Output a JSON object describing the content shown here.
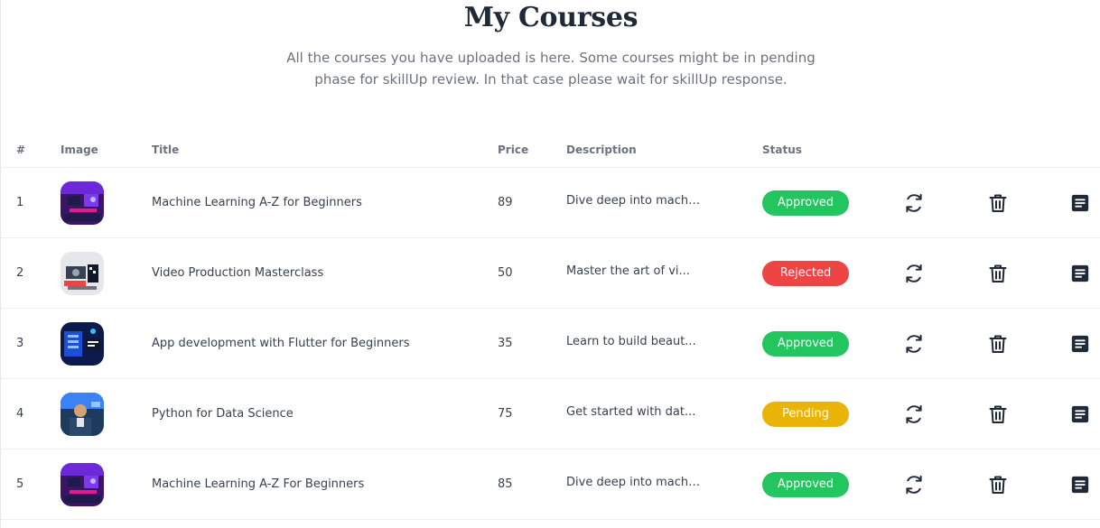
{
  "header": {
    "title": "My Courses",
    "subtitle": "All the courses you have uploaded is here. Some courses might be in pending phase for skillUp review. In that case please wait for skillUp response."
  },
  "table": {
    "columns": [
      "#",
      "Image",
      "Title",
      "Price",
      "Description",
      "Status"
    ],
    "rows": [
      {
        "num": "1",
        "image": "ml-thumbnail",
        "title": "Machine Learning A-Z for Beginners",
        "price": "89",
        "description": "Dive deep into machi...",
        "status": "Approved"
      },
      {
        "num": "2",
        "image": "video-thumbnail",
        "title": "Video Production Masterclass",
        "price": "50",
        "description": "Master the art of vi...",
        "status": "Rejected"
      },
      {
        "num": "3",
        "image": "flutter-thumbnail",
        "title": "App development with Flutter for Beginners",
        "price": "35",
        "description": "Learn to build beaut...",
        "status": "Approved"
      },
      {
        "num": "4",
        "image": "python-thumbnail",
        "title": "Python for Data Science",
        "price": "75",
        "description": "Get started with dat...",
        "status": "Pending"
      },
      {
        "num": "5",
        "image": "ml-thumbnail",
        "title": "Machine Learning A-Z For Beginners",
        "price": "85",
        "description": "Dive deep into machi...",
        "status": "Approved"
      }
    ]
  },
  "status_colors": {
    "Approved": "#22c55e",
    "Rejected": "#ef4444",
    "Pending": "#eab308"
  },
  "icons": {
    "update": "refresh-icon",
    "delete": "trash-icon",
    "details": "notes-icon"
  }
}
